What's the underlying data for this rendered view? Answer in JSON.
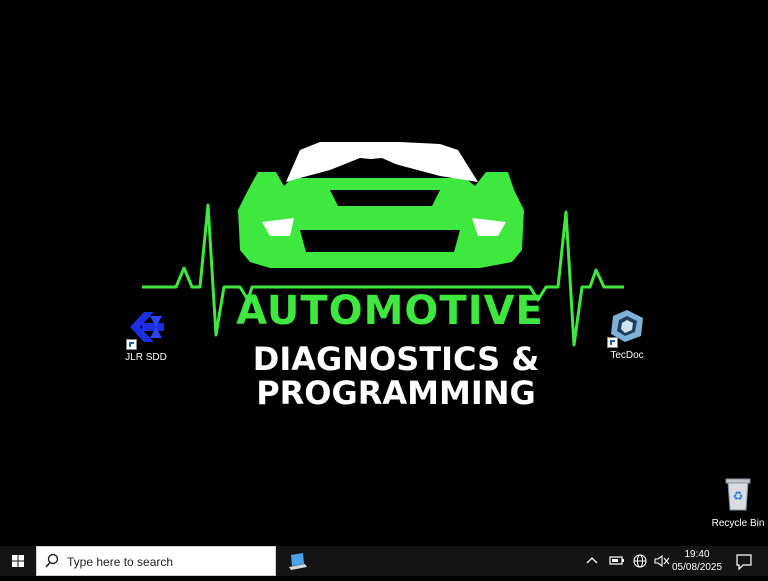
{
  "wallpaper": {
    "line1": "AUTOMOTIVE",
    "line2": "DIAGNOSTICS &",
    "line3": "PROGRAMMING",
    "colors": {
      "accent": "#3ee83e",
      "text": "#ffffff",
      "background": "#000000"
    }
  },
  "desktop_icons": [
    {
      "label": "JLR SDD",
      "icon": "jlr-sdd-icon"
    },
    {
      "label": "TecDoc",
      "icon": "tecdoc-icon"
    },
    {
      "label": "Recycle Bin",
      "icon": "recycle-bin-icon"
    }
  ],
  "taskbar": {
    "search_placeholder": "Type here to search",
    "pinned_app_icon": "laptop-app-icon",
    "tray_icons": [
      "chevron-up-icon",
      "battery-icon",
      "globe-network-icon",
      "speaker-muted-icon"
    ],
    "time": "19:40",
    "date": "05/08/2025",
    "notification_icon": "notification-icon"
  }
}
